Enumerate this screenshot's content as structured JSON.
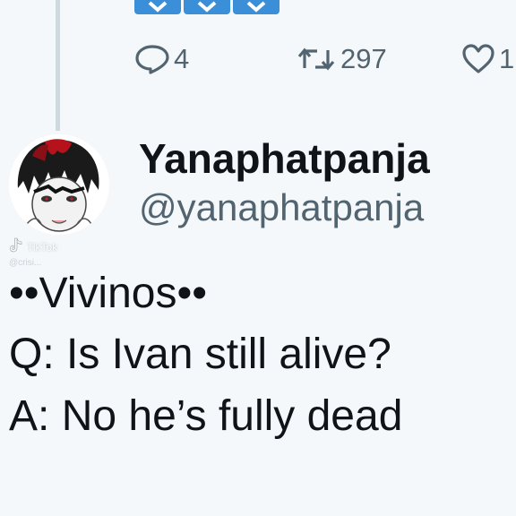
{
  "previous_tweet": {
    "reply_count": "4",
    "retweet_count": "297",
    "like_count": "1"
  },
  "tweet": {
    "display_name": "Yanaphatpanja",
    "handle": "@yanaphatpanja",
    "lines": [
      "••Vivinos••",
      "Q: Is Ivan still alive?",
      "A: No he’s fully dead"
    ]
  },
  "watermark": {
    "brand": "TikTok",
    "user": "@crisi..."
  },
  "icons": {
    "reply": "comment-icon",
    "retweet": "retweet-icon",
    "like": "heart-icon",
    "watermark": "tiktok-logo-icon"
  },
  "colors": {
    "background": "#f5f8fa",
    "text": "#0f1419",
    "muted": "#536471",
    "emoji_blue": "#3b8fd9"
  }
}
